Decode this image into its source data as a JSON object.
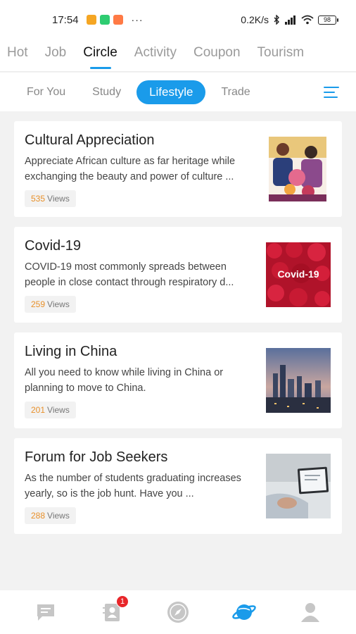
{
  "status_bar": {
    "time": "17:54",
    "dots": "···",
    "net_speed": "0.2K/s",
    "battery": "98"
  },
  "top_tabs": [
    {
      "label": "Hot"
    },
    {
      "label": "Job"
    },
    {
      "label": "Circle",
      "active": true
    },
    {
      "label": "Activity"
    },
    {
      "label": "Coupon"
    },
    {
      "label": "Tourism"
    }
  ],
  "sub_tabs": [
    {
      "label": "For You"
    },
    {
      "label": "Study"
    },
    {
      "label": "Lifestyle",
      "active": true
    },
    {
      "label": "Trade"
    }
  ],
  "posts": [
    {
      "title": "Cultural Appreciation",
      "description": "Appreciate African culture as far heritage while exchanging the beauty and power of culture ...",
      "views_count": "535",
      "views_label": "Views"
    },
    {
      "title": "Covid-19",
      "description": "COVID-19 most commonly spreads between people in close contact through respiratory d...",
      "views_count": "259",
      "views_label": "Views",
      "thumb_text": "Covid-19"
    },
    {
      "title": "Living in China",
      "description": "All you need to know while living in China or planning to move to China.",
      "views_count": "201",
      "views_label": "Views"
    },
    {
      "title": "Forum for Job Seekers",
      "description": "As the number of students graduating increases yearly, so is the job hunt. Have you ...",
      "views_count": "288",
      "views_label": "Views"
    }
  ],
  "bottom_nav": {
    "contacts_badge": "1"
  },
  "colors": {
    "accent": "#1a9bea",
    "views_count": "#e8902a",
    "badge": "#e8262a"
  }
}
